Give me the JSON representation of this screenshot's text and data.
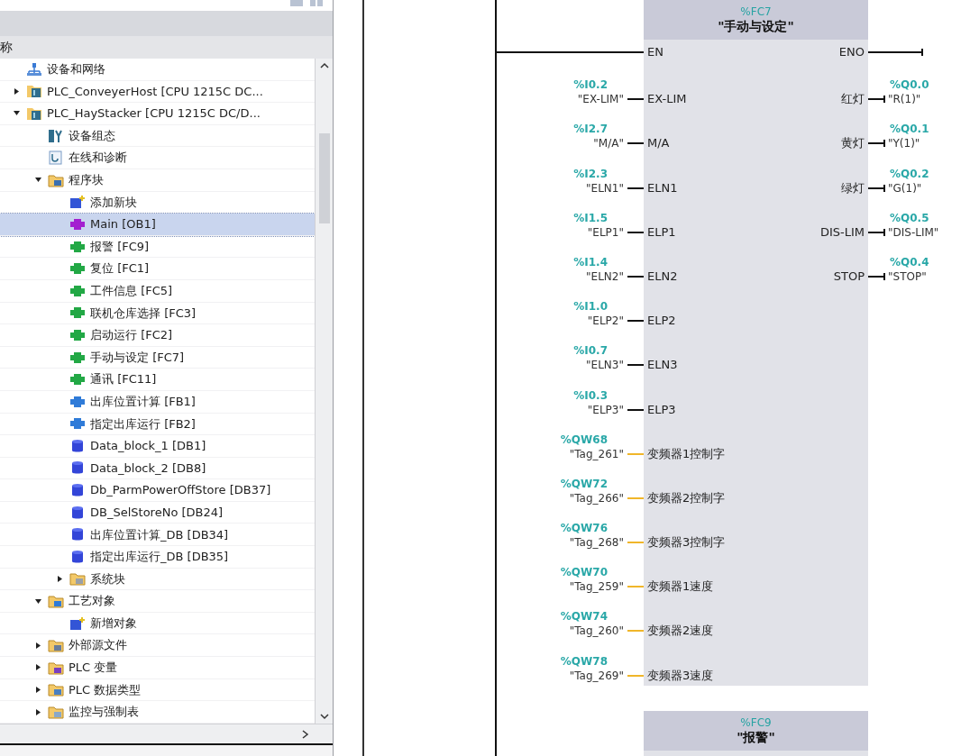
{
  "tree": {
    "header": "称",
    "items": [
      {
        "name": "设备和网络",
        "kind": "network"
      },
      {
        "name": "PLC_ConveyerHost [CPU 1215C DC...",
        "kind": "plc",
        "expanded": false,
        "selected": false
      },
      {
        "name": "PLC_HayStacker [CPU 1215C DC/D...",
        "kind": "plc",
        "expanded": true,
        "selected": false,
        "children": [
          {
            "name": "设备组态",
            "kind": "config"
          },
          {
            "name": "在线和诊断",
            "kind": "diag"
          },
          {
            "name": "程序块",
            "kind": "blocks-folder",
            "expanded": true,
            "children": [
              {
                "name": "添加新块",
                "kind": "add"
              },
              {
                "name": "Main [OB1]",
                "kind": "ob",
                "selected": true
              },
              {
                "name": "报警 [FC9]",
                "kind": "fc",
                "selected": false
              },
              {
                "name": "复位 [FC1]",
                "kind": "fc",
                "selected": false
              },
              {
                "name": "工件信息 [FC5]",
                "kind": "fc",
                "selected": false
              },
              {
                "name": "联机仓库选择 [FC3]",
                "kind": "fc",
                "selected": false
              },
              {
                "name": "启动运行 [FC2]",
                "kind": "fc",
                "selected": false
              },
              {
                "name": "手动与设定 [FC7]",
                "kind": "fc",
                "selected": false
              },
              {
                "name": "通讯 [FC11]",
                "kind": "fc",
                "selected": false
              },
              {
                "name": "出库位置计算 [FB1]",
                "kind": "fb",
                "selected": false
              },
              {
                "name": "指定出库运行 [FB2]",
                "kind": "fb",
                "selected": false
              },
              {
                "name": "Data_block_1 [DB1]",
                "kind": "db",
                "selected": false
              },
              {
                "name": "Data_block_2 [DB8]",
                "kind": "db",
                "selected": false
              },
              {
                "name": "Db_ParmPowerOffStore [DB37]",
                "kind": "db",
                "selected": false
              },
              {
                "name": "DB_SelStoreNo [DB24]",
                "kind": "db",
                "selected": false
              },
              {
                "name": "出库位置计算_DB [DB34]",
                "kind": "db",
                "selected": false
              },
              {
                "name": "指定出库运行_DB [DB35]",
                "kind": "db",
                "selected": false
              },
              {
                "name": "系统块",
                "kind": "system-folder",
                "expanded": false
              }
            ]
          },
          {
            "name": "工艺对象",
            "kind": "tech-folder",
            "expanded": true,
            "children": [
              {
                "name": "新增对象",
                "kind": "add"
              }
            ]
          },
          {
            "name": "外部源文件",
            "kind": "source-folder",
            "expanded": false
          },
          {
            "name": "PLC 变量",
            "kind": "tag-folder",
            "expanded": false
          },
          {
            "name": "PLC 数据类型",
            "kind": "type-folder",
            "expanded": false
          },
          {
            "name": "监控与强制表",
            "kind": "watch-folder",
            "expanded": false
          }
        ]
      }
    ]
  },
  "diagram": {
    "blocks": [
      {
        "address": "%FC7",
        "title": "\"手动与设定\"",
        "en": "EN",
        "eno": "ENO",
        "inputs": [
          {
            "address": "%I0.2",
            "tag": "\"EX-LIM\"",
            "pin": "EX-LIM",
            "kind": "bool"
          },
          {
            "address": "%I2.7",
            "tag": "\"M/A\"",
            "pin": "M/A",
            "kind": "bool"
          },
          {
            "address": "%I2.3",
            "tag": "\"ELN1\"",
            "pin": "ELN1",
            "kind": "bool"
          },
          {
            "address": "%I1.5",
            "tag": "\"ELP1\"",
            "pin": "ELP1",
            "kind": "bool"
          },
          {
            "address": "%I1.4",
            "tag": "\"ELN2\"",
            "pin": "ELN2",
            "kind": "bool"
          },
          {
            "address": "%I1.0",
            "tag": "\"ELP2\"",
            "pin": "ELP2",
            "kind": "bool"
          },
          {
            "address": "%I0.7",
            "tag": "\"ELN3\"",
            "pin": "ELN3",
            "kind": "bool"
          },
          {
            "address": "%I0.3",
            "tag": "\"ELP3\"",
            "pin": "ELP3",
            "kind": "bool"
          },
          {
            "address": "%QW68",
            "tag": "\"Tag_261\"",
            "pin": "变频器1控制字",
            "kind": "word"
          },
          {
            "address": "%QW72",
            "tag": "\"Tag_266\"",
            "pin": "变频器2控制字",
            "kind": "word"
          },
          {
            "address": "%QW76",
            "tag": "\"Tag_268\"",
            "pin": "变频器3控制字",
            "kind": "word"
          },
          {
            "address": "%QW70",
            "tag": "\"Tag_259\"",
            "pin": "变频器1速度",
            "kind": "word"
          },
          {
            "address": "%QW74",
            "tag": "\"Tag_260\"",
            "pin": "变频器2速度",
            "kind": "word"
          },
          {
            "address": "%QW78",
            "tag": "\"Tag_269\"",
            "pin": "变频器3速度",
            "kind": "word"
          }
        ],
        "outputs": [
          {
            "address": "%Q0.0",
            "tag": "\"R(1)\"",
            "pin": "红灯"
          },
          {
            "address": "%Q0.1",
            "tag": "\"Y(1)\"",
            "pin": "黄灯"
          },
          {
            "address": "%Q0.2",
            "tag": "\"G(1)\"",
            "pin": "绿灯"
          },
          {
            "address": "%Q0.5",
            "tag": "\"DIS-LIM\"",
            "pin": "DIS-LIM"
          },
          {
            "address": "%Q0.4",
            "tag": "\"STOP\"",
            "pin": "STOP"
          }
        ]
      },
      {
        "address": "%FC9",
        "title": "\"报警\""
      }
    ]
  }
}
